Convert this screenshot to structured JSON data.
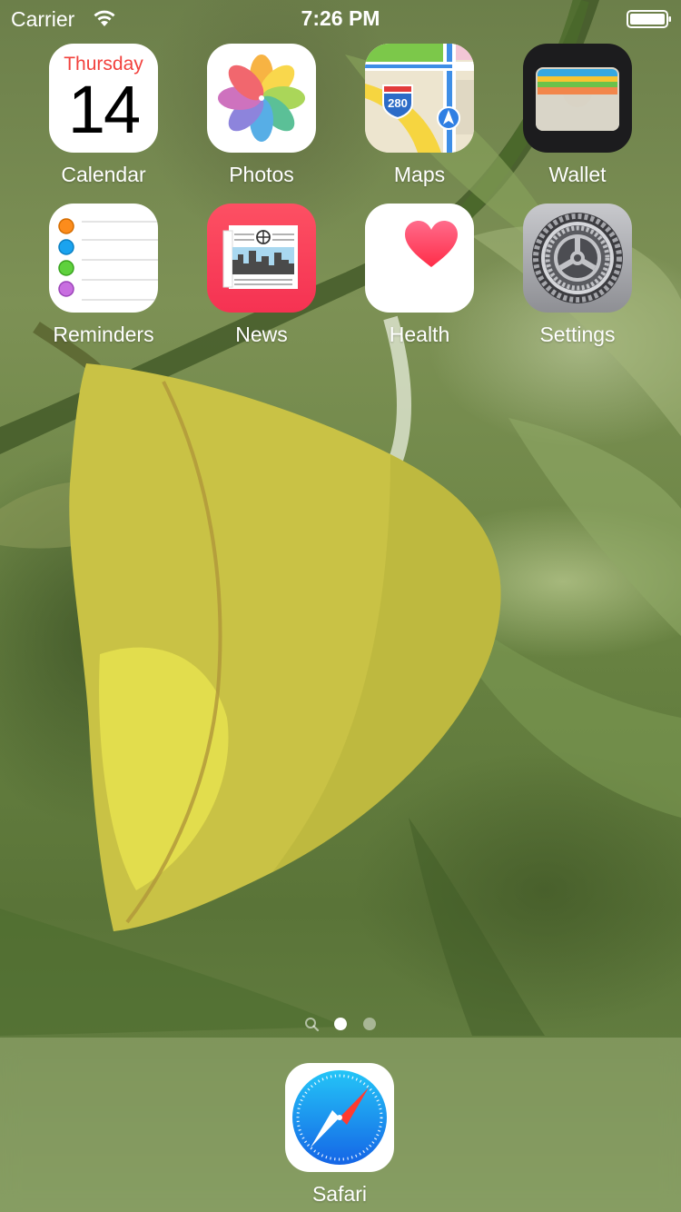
{
  "status_bar": {
    "carrier": "Carrier",
    "time": "7:26 PM",
    "wifi_icon": "wifi-icon",
    "battery_icon": "battery-full-icon"
  },
  "home_screen": {
    "apps": [
      {
        "label": "Calendar",
        "icon": "calendar-icon",
        "day": "Thursday",
        "date": "14"
      },
      {
        "label": "Photos",
        "icon": "photos-icon"
      },
      {
        "label": "Maps",
        "icon": "maps-icon",
        "shield_number": "280"
      },
      {
        "label": "Wallet",
        "icon": "wallet-icon"
      },
      {
        "label": "Reminders",
        "icon": "reminders-icon"
      },
      {
        "label": "News",
        "icon": "news-icon"
      },
      {
        "label": "Health",
        "icon": "health-icon"
      },
      {
        "label": "Settings",
        "icon": "settings-icon"
      }
    ],
    "page_indicator": {
      "pages": 2,
      "current_page": 1,
      "has_search_page": true
    }
  },
  "dock": {
    "apps": [
      {
        "label": "Safari",
        "icon": "safari-icon"
      }
    ]
  },
  "colors": {
    "calendar_day": "#f2413d",
    "news_background": "#fa3d55",
    "health_heart": "#ff3b5c",
    "wallet_background": "#1c1c1e",
    "safari_blue": "#1d8ff2"
  }
}
